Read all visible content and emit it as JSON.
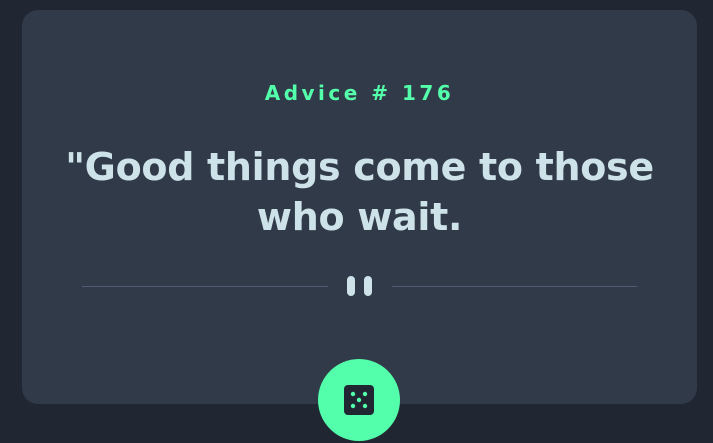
{
  "advice": {
    "id_label": "Advice # 176",
    "text": "\"Good things come to those who wait."
  },
  "divider": {
    "icon": "pause-icon"
  },
  "button": {
    "icon": "dice-icon",
    "aria_label": "Generate new advice"
  },
  "colors": {
    "background": "#202632",
    "card": "#313a48",
    "accent": "#53ffaa",
    "text": "#cee3e9",
    "divider_line": "#4f5d74"
  }
}
